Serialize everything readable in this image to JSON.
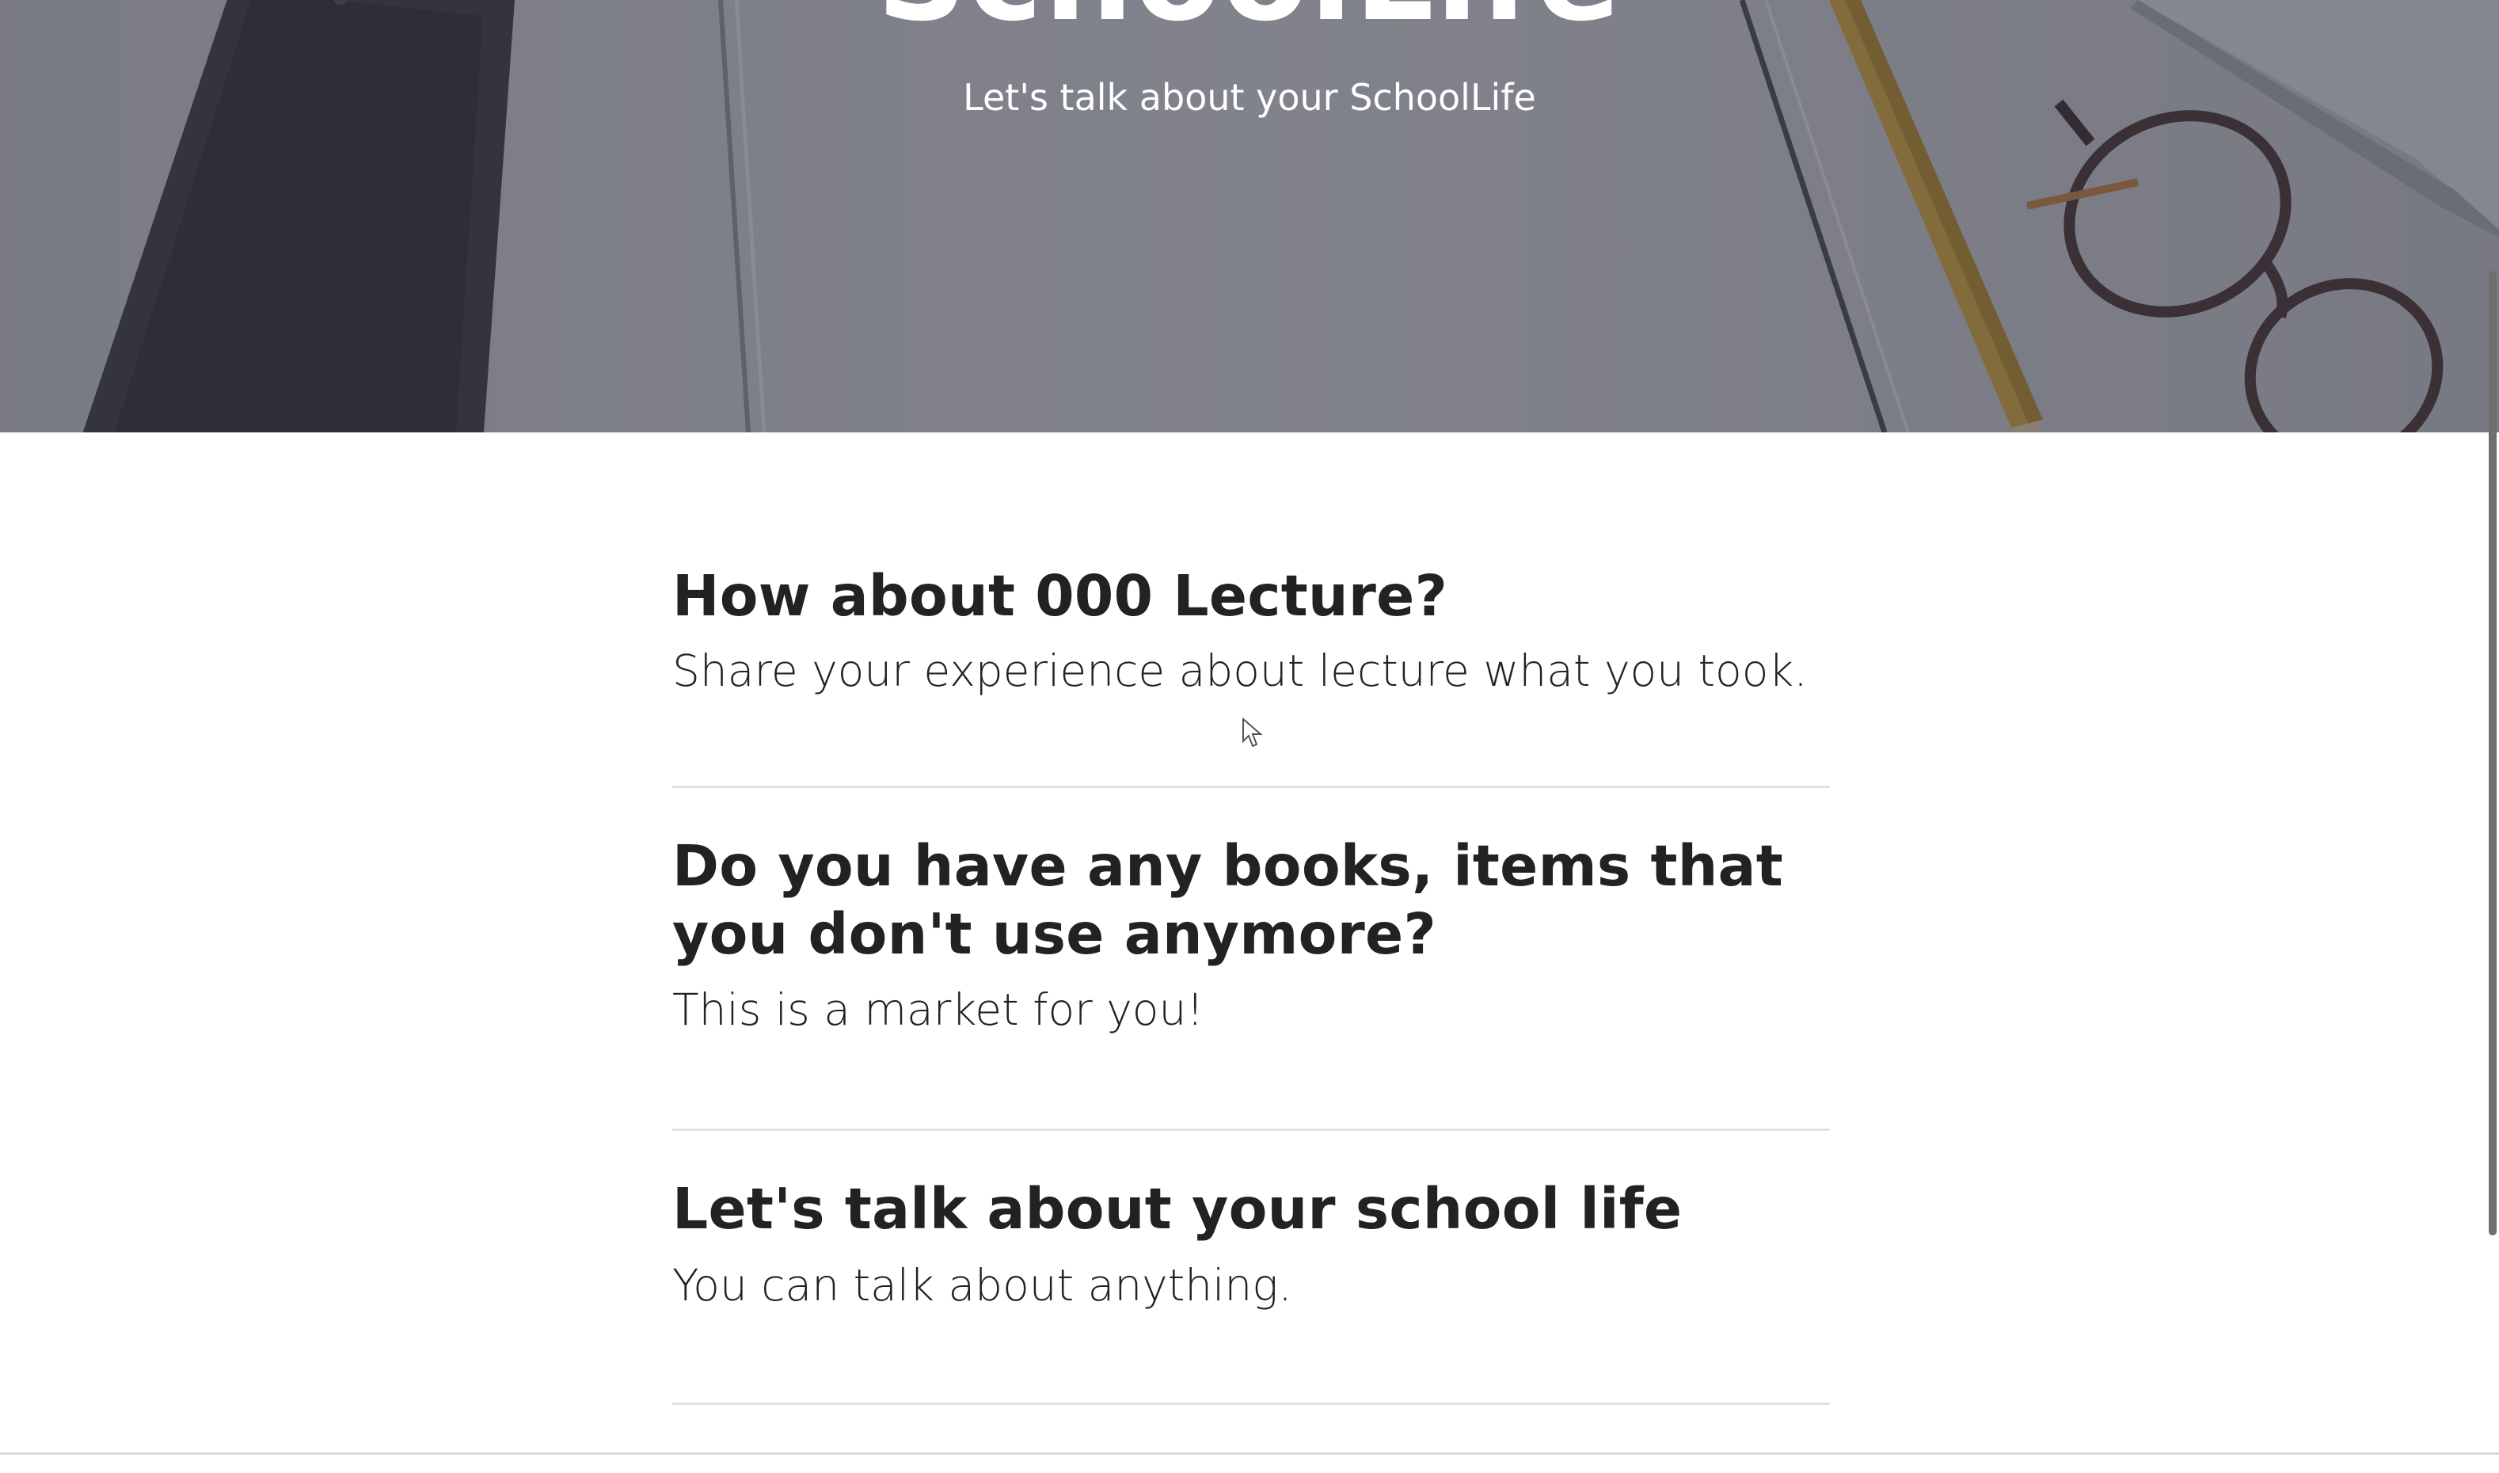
{
  "hero": {
    "title": "SchoolLife",
    "subtitle": "Let's talk about your SchoolLife"
  },
  "posts": [
    {
      "title": "How about 000 Lecture?",
      "subtitle": "Share your experience about lecture what you took."
    },
    {
      "title": "Do you have any books, items that you don't use anymore?",
      "subtitle": "This is a market for you!"
    },
    {
      "title": "Let's talk about your school life",
      "subtitle": "You can talk about anything."
    }
  ],
  "icons": {
    "hero_items": [
      "smartphone-icon",
      "pencil-icon",
      "glasses-icon"
    ],
    "pointer": "mouse-cursor-icon"
  },
  "colors": {
    "text": "#222222",
    "divider": "#e3e3e3",
    "hero_overlay": "#6e7079",
    "hero_text": "#ffffff"
  }
}
